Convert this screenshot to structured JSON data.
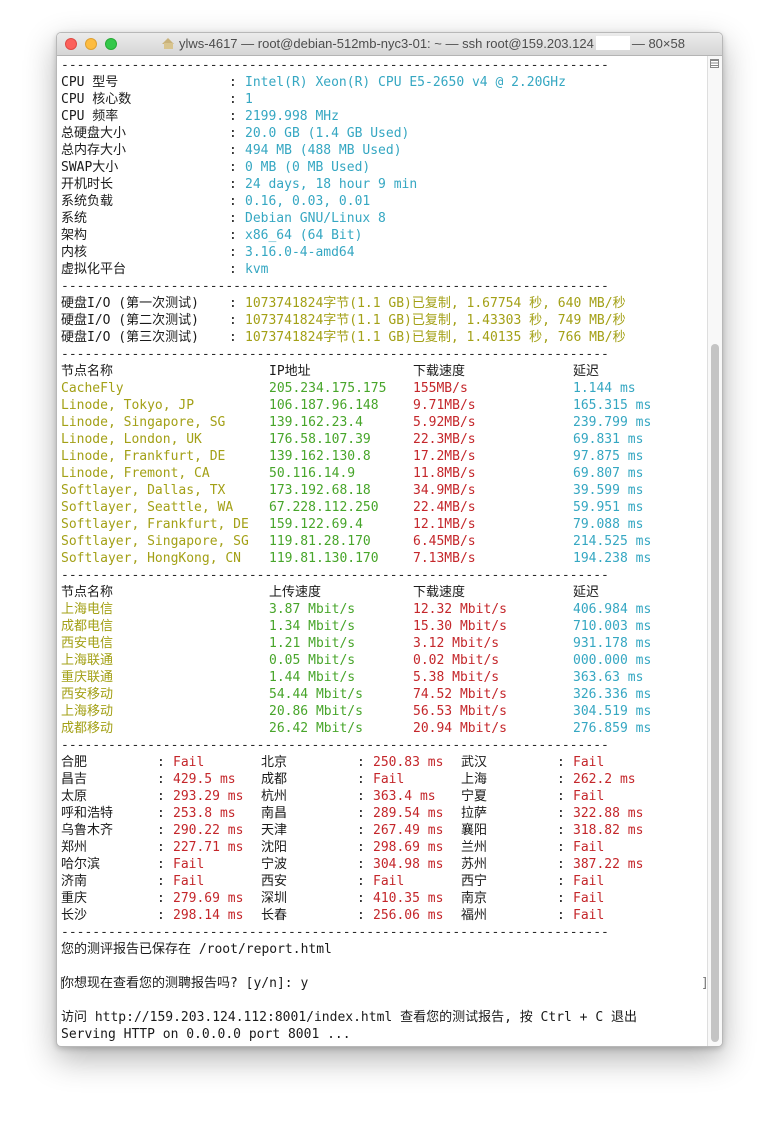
{
  "window": {
    "title_before": "ylws-4617 — root@debian-512mb-nyc3-01: ~ — ssh root@159.203.124",
    "title_after": "— 80×58"
  },
  "separator": "----------------------------------------------------------------------",
  "sysinfo": [
    {
      "label": "CPU 型号",
      "value": "Intel(R) Xeon(R) CPU E5-2650 v4 @ 2.20GHz"
    },
    {
      "label": "CPU 核心数",
      "value": "1"
    },
    {
      "label": "CPU 频率",
      "value": "2199.998 MHz"
    },
    {
      "label": "总硬盘大小",
      "value": "20.0 GB (1.4 GB Used)"
    },
    {
      "label": "总内存大小",
      "value": "494 MB (488 MB Used)"
    },
    {
      "label": "SWAP大小",
      "value": "0 MB (0 MB Used)"
    },
    {
      "label": "开机时长",
      "value": "24 days, 18 hour 9 min"
    },
    {
      "label": "系统负载",
      "value": "0.16, 0.03, 0.01"
    },
    {
      "label": "系统",
      "value": "Debian GNU/Linux 8"
    },
    {
      "label": "架构",
      "value": "x86_64 (64 Bit)"
    },
    {
      "label": "内核",
      "value": "3.16.0-4-amd64"
    },
    {
      "label": "虚拟化平台",
      "value": "kvm"
    }
  ],
  "disk_io": [
    {
      "label": "硬盘I/O (第一次测试)",
      "value": "1073741824字节(1.1 GB)已复制, 1.67754 秒, 640 MB/秒"
    },
    {
      "label": "硬盘I/O (第二次测试)",
      "value": "1073741824字节(1.1 GB)已复制, 1.43303 秒, 749 MB/秒"
    },
    {
      "label": "硬盘I/O (第三次测试)",
      "value": "1073741824字节(1.1 GB)已复制, 1.40135 秒, 766 MB/秒"
    }
  ],
  "speed_headers": [
    "节点名称",
    "IP地址",
    "下载速度",
    "延迟"
  ],
  "speed_rows": [
    {
      "node": "CacheFly",
      "ip": "205.234.175.175",
      "speed": "155MB/s",
      "latency": "1.144 ms"
    },
    {
      "node": "Linode, Tokyo, JP",
      "ip": "106.187.96.148",
      "speed": "9.71MB/s",
      "latency": "165.315 ms"
    },
    {
      "node": "Linode, Singapore, SG",
      "ip": "139.162.23.4",
      "speed": "5.92MB/s",
      "latency": "239.799 ms"
    },
    {
      "node": "Linode, London, UK",
      "ip": "176.58.107.39",
      "speed": "22.3MB/s",
      "latency": "69.831 ms"
    },
    {
      "node": "Linode, Frankfurt, DE",
      "ip": "139.162.130.8",
      "speed": "17.2MB/s",
      "latency": "97.875 ms"
    },
    {
      "node": "Linode, Fremont, CA",
      "ip": "50.116.14.9",
      "speed": "11.8MB/s",
      "latency": "69.807 ms"
    },
    {
      "node": "Softlayer, Dallas, TX",
      "ip": "173.192.68.18",
      "speed": "34.9MB/s",
      "latency": "39.599 ms"
    },
    {
      "node": "Softlayer, Seattle, WA",
      "ip": "67.228.112.250",
      "speed": "22.4MB/s",
      "latency": "59.951 ms"
    },
    {
      "node": "Softlayer, Frankfurt, DE",
      "ip": "159.122.69.4",
      "speed": "12.1MB/s",
      "latency": "79.088 ms"
    },
    {
      "node": "Softlayer, Singapore, SG",
      "ip": "119.81.28.170",
      "speed": "6.45MB/s",
      "latency": "214.525 ms"
    },
    {
      "node": "Softlayer, HongKong, CN",
      "ip": "119.81.130.170",
      "speed": "7.13MB/s",
      "latency": "194.238 ms"
    }
  ],
  "cn_headers": [
    "节点名称",
    "上传速度",
    "下载速度",
    "延迟"
  ],
  "cn_rows": [
    {
      "node": "上海电信",
      "up": "3.87 Mbit/s",
      "down": "12.32 Mbit/s",
      "latency": "406.984 ms"
    },
    {
      "node": "成都电信",
      "up": "1.34 Mbit/s",
      "down": "15.30 Mbit/s",
      "latency": "710.003 ms"
    },
    {
      "node": "西安电信",
      "up": "1.21 Mbit/s",
      "down": "3.12 Mbit/s",
      "latency": "931.178 ms"
    },
    {
      "node": "上海联通",
      "up": "0.05 Mbit/s",
      "down": "0.02 Mbit/s",
      "latency": "000.000 ms"
    },
    {
      "node": "重庆联通",
      "up": "1.44 Mbit/s",
      "down": "5.38 Mbit/s",
      "latency": "363.63 ms"
    },
    {
      "node": "西安移动",
      "up": "54.44 Mbit/s",
      "down": "74.52 Mbit/s",
      "latency": "326.336 ms"
    },
    {
      "node": "上海移动",
      "up": "20.86 Mbit/s",
      "down": "56.53 Mbit/s",
      "latency": "304.519 ms"
    },
    {
      "node": "成都移动",
      "up": "26.42 Mbit/s",
      "down": "20.94 Mbit/s",
      "latency": "276.859 ms"
    }
  ],
  "ping_rows": [
    [
      {
        "city": "合肥",
        "value": "Fail"
      },
      {
        "city": "北京",
        "value": "250.83 ms"
      },
      {
        "city": "武汉",
        "value": "Fail"
      }
    ],
    [
      {
        "city": "昌吉",
        "value": "429.5 ms"
      },
      {
        "city": "成都",
        "value": "Fail"
      },
      {
        "city": "上海",
        "value": "262.2 ms"
      }
    ],
    [
      {
        "city": "太原",
        "value": "293.29 ms"
      },
      {
        "city": "杭州",
        "value": "363.4 ms"
      },
      {
        "city": "宁夏",
        "value": "Fail"
      }
    ],
    [
      {
        "city": "呼和浩特",
        "value": "253.8 ms"
      },
      {
        "city": "南昌",
        "value": "289.54 ms"
      },
      {
        "city": "拉萨",
        "value": "322.88 ms"
      }
    ],
    [
      {
        "city": "乌鲁木齐",
        "value": "290.22 ms"
      },
      {
        "city": "天津",
        "value": "267.49 ms"
      },
      {
        "city": "襄阳",
        "value": "318.82 ms"
      }
    ],
    [
      {
        "city": "郑州",
        "value": "227.71 ms"
      },
      {
        "city": "沈阳",
        "value": "298.69 ms"
      },
      {
        "city": "兰州",
        "value": "Fail"
      }
    ],
    [
      {
        "city": "哈尔滨",
        "value": "Fail"
      },
      {
        "city": "宁波",
        "value": "304.98 ms"
      },
      {
        "city": "苏州",
        "value": "387.22 ms"
      }
    ],
    [
      {
        "city": "济南",
        "value": "Fail"
      },
      {
        "city": "西安",
        "value": "Fail"
      },
      {
        "city": "西宁",
        "value": "Fail"
      }
    ],
    [
      {
        "city": "重庆",
        "value": "279.69 ms"
      },
      {
        "city": "深圳",
        "value": "410.35 ms"
      },
      {
        "city": "南京",
        "value": "Fail"
      }
    ],
    [
      {
        "city": "长沙",
        "value": "298.14 ms"
      },
      {
        "city": "长春",
        "value": "256.06 ms"
      },
      {
        "city": "福州",
        "value": "Fail"
      }
    ]
  ],
  "footer": {
    "saved": "您的测评报告已保存在 /root/report.html",
    "prompt": "你想现在查看您的测聘报告吗? [y/n]: y",
    "visit": "访问 http://159.203.124.112:8001/index.html 查看您的测试报告, 按 Ctrl + C 退出",
    "serving": "Serving HTTP on 0.0.0.0 port 8001 ..."
  },
  "colors": {
    "label": "#1a1a1a",
    "value_cyan": "#35a7c2",
    "node_olive": "#a3a016",
    "ip_green": "#47a52a",
    "speed_red": "#c4262a"
  }
}
